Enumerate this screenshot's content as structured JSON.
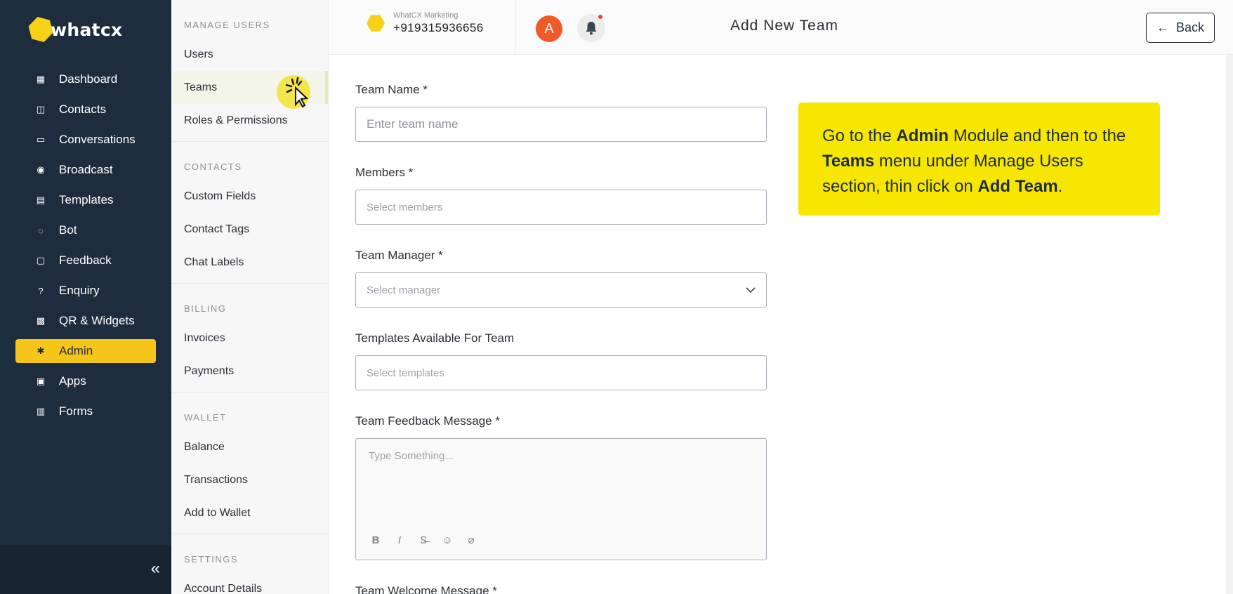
{
  "brand": {
    "logo_text": "whatcx",
    "accent_color": "#f5c51a",
    "sidebar_color": "#1e2d3d"
  },
  "sidebar": {
    "items": [
      {
        "label": "Dashboard",
        "icon": "grid-icon",
        "glyph": "▦",
        "active": false
      },
      {
        "label": "Contacts",
        "icon": "contacts-icon",
        "glyph": "◫",
        "active": false
      },
      {
        "label": "Conversations",
        "icon": "chat-icon",
        "glyph": "▭",
        "active": false
      },
      {
        "label": "Broadcast",
        "icon": "broadcast-icon",
        "glyph": "◉",
        "active": false
      },
      {
        "label": "Templates",
        "icon": "template-icon",
        "glyph": "▤",
        "active": false
      },
      {
        "label": "Bot",
        "icon": "bot-icon",
        "glyph": "◌",
        "active": false
      },
      {
        "label": "Feedback",
        "icon": "feedback-icon",
        "glyph": "▢",
        "active": false
      },
      {
        "label": "Enquiry",
        "icon": "question-icon",
        "glyph": "?",
        "active": false
      },
      {
        "label": "QR & Widgets",
        "icon": "qr-icon",
        "glyph": "▩",
        "active": false
      },
      {
        "label": "Admin",
        "icon": "gear-icon",
        "glyph": "✱",
        "active": true
      },
      {
        "label": "Apps",
        "icon": "apps-icon",
        "glyph": "▣",
        "active": false
      },
      {
        "label": "Forms",
        "icon": "clipboard-icon",
        "glyph": "▥",
        "active": false
      }
    ],
    "collapse_glyph": "«"
  },
  "submenu": {
    "sections": [
      {
        "title": "MANAGE USERS",
        "items": [
          "Users",
          "Teams",
          "Roles & Permissions"
        ]
      },
      {
        "title": "CONTACTS",
        "items": [
          "Custom Fields",
          "Contact Tags",
          "Chat Labels"
        ]
      },
      {
        "title": "BILLING",
        "items": [
          "Invoices",
          "Payments"
        ]
      },
      {
        "title": "WALLET",
        "items": [
          "Balance",
          "Transactions",
          "Add to Wallet"
        ]
      },
      {
        "title": "SETTINGS",
        "items": [
          "Account Details"
        ]
      }
    ],
    "active_item": "Teams"
  },
  "topbar": {
    "account_name": "WhatCX Marketing",
    "account_phone": "+919315936656",
    "avatar_letter": "A",
    "page_title": "Add New Team",
    "back_label": "Back",
    "back_glyph": "←"
  },
  "form": {
    "team_name": {
      "label": "Team Name *",
      "placeholder": "Enter team name"
    },
    "members": {
      "label": "Members *",
      "placeholder": "Select members"
    },
    "team_manager": {
      "label": "Team Manager *",
      "placeholder": "Select manager"
    },
    "templates": {
      "label": "Templates Available For Team",
      "placeholder": "Select templates"
    },
    "feedback_message": {
      "label": "Team Feedback Message *",
      "placeholder": "Type Something..."
    },
    "welcome_message": {
      "label": "Team Welcome Message *"
    },
    "toolbar": [
      {
        "name": "bold-icon",
        "glyph": "B"
      },
      {
        "name": "italic-icon",
        "glyph": "I"
      },
      {
        "name": "strikethrough-icon",
        "glyph": "S̶"
      },
      {
        "name": "emoji-icon",
        "glyph": "☺"
      },
      {
        "name": "attachment-icon",
        "glyph": "⌀"
      }
    ]
  },
  "callout": {
    "parts": [
      {
        "text": "Go to the ",
        "bold": false
      },
      {
        "text": "Admin",
        "bold": true
      },
      {
        "text": " Module and then to the ",
        "bold": false
      },
      {
        "text": "Teams",
        "bold": true
      },
      {
        "text": " menu under Manage Users section, thin click on ",
        "bold": false
      },
      {
        "text": "Add Team",
        "bold": true
      },
      {
        "text": ".",
        "bold": false
      }
    ]
  }
}
